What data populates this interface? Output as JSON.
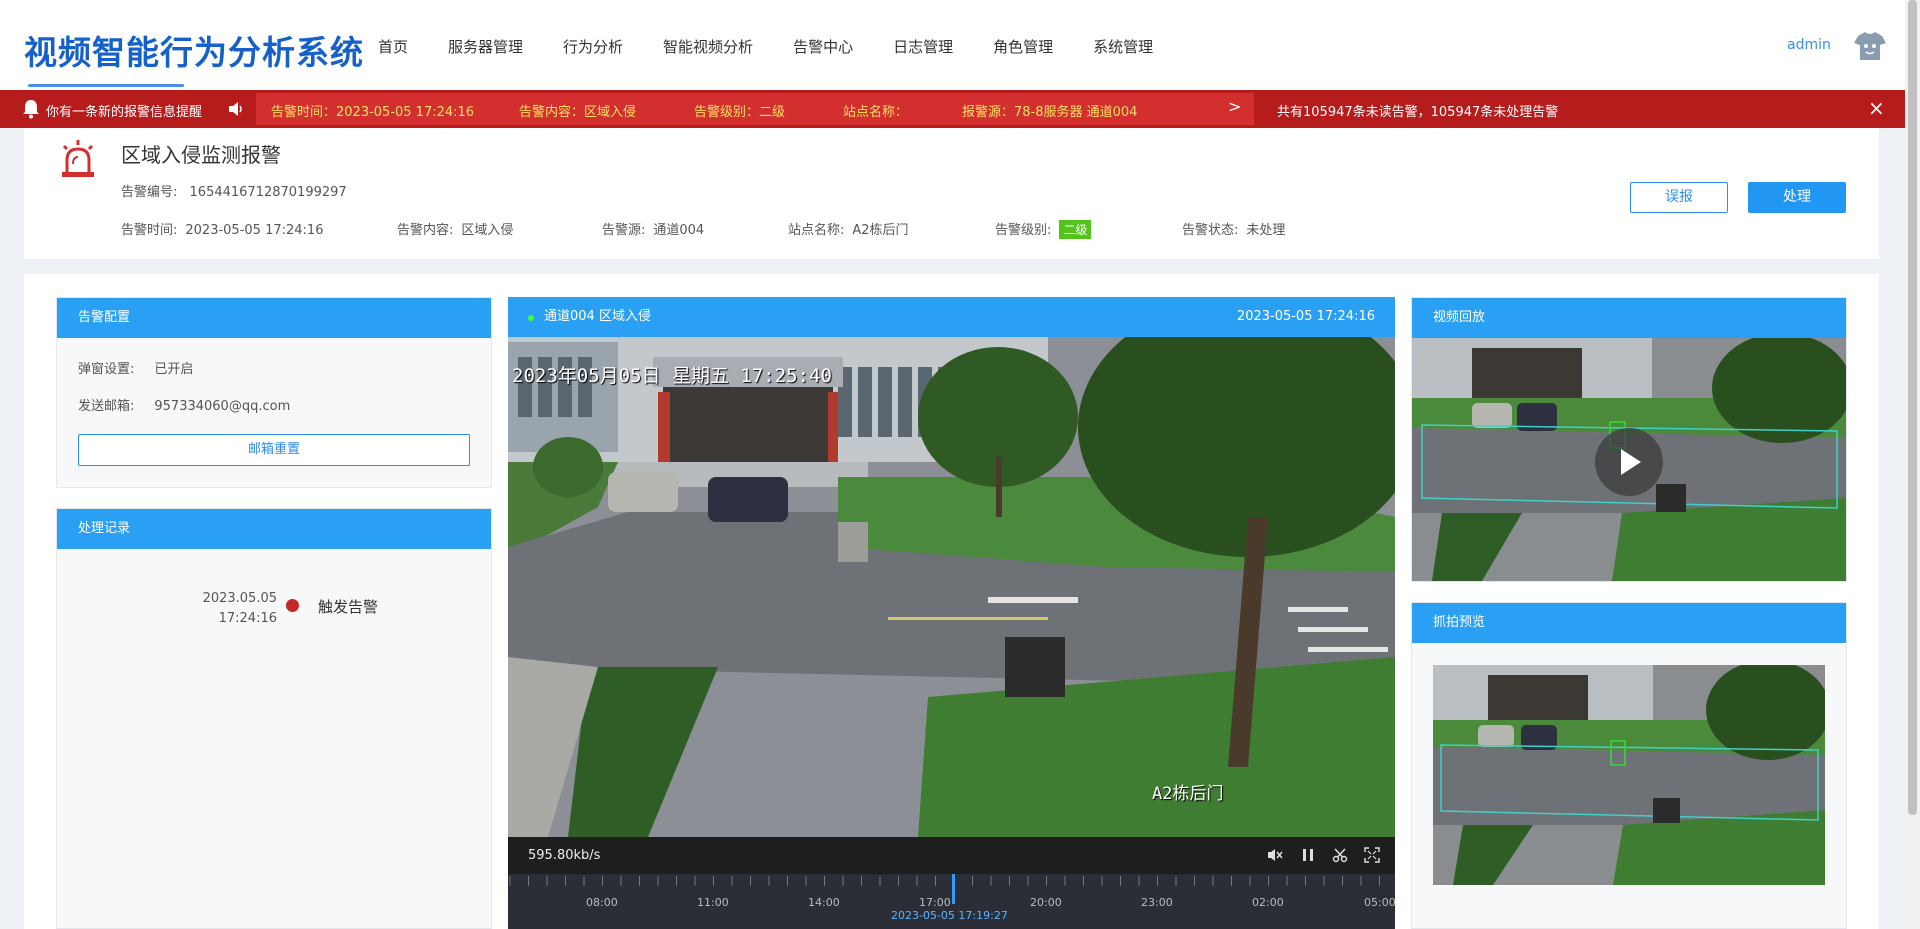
{
  "header": {
    "app_title": "视频智能行为分析系统",
    "nav": [
      "首页",
      "服务器管理",
      "行为分析",
      "智能视频分析",
      "告警中心",
      "日志管理",
      "角色管理",
      "系统管理"
    ],
    "user": "admin"
  },
  "alert_bar": {
    "new_message": "你有一条新的报警信息提醒",
    "time": "告警时间：2023-05-05 17:24:16",
    "content": "告警内容：区域入侵",
    "level": "告警级别：二级",
    "site": "站点名称：",
    "source": "报警源：78-8服务器 通道004",
    "chevron": ">",
    "summary": "共有105947条未读告警，105947条未处理告警",
    "close": "×"
  },
  "alarm": {
    "title": "区域入侵监测报警",
    "number_label": "告警编号:",
    "number": "1654416712870199297",
    "time_label": "告警时间:",
    "time": "2023-05-05 17:24:16",
    "content_label": "告警内容:",
    "content": "区域入侵",
    "source_label": "告警源:",
    "source": "通道004",
    "site_label": "站点名称:",
    "site": "A2栋后门",
    "level_label": "告警级别:",
    "level": "二级",
    "status_label": "告警状态:",
    "status": "未处理",
    "btn_misreport": "误报",
    "btn_handle": "处理"
  },
  "config": {
    "title": "告警配置",
    "popup_label": "弹窗设置:",
    "popup_value": "已开启",
    "email_label": "发送邮箱:",
    "email_value": "957334060@qq.com",
    "reset_btn": "邮箱重置"
  },
  "records": {
    "title": "处理记录",
    "items": [
      {
        "date": "2023.05.05",
        "time": "17:24:16",
        "event": "触发告警"
      }
    ]
  },
  "video": {
    "title": "通道004 区域入侵",
    "timestamp": "2023-05-05 17:24:16",
    "osd_time": "2023年05月05日 星期五 17:25:40",
    "osd_label": "A2栋后门",
    "bitrate": "595.80kb/s",
    "timeline_labels": [
      "08:00",
      "11:00",
      "14:00",
      "17:00",
      "20:00",
      "23:00",
      "02:00",
      "05:00"
    ],
    "timeline_current": "2023-05-05 17:19:27"
  },
  "playback": {
    "title": "视频回放"
  },
  "snapshot": {
    "title": "抓拍预览"
  }
}
